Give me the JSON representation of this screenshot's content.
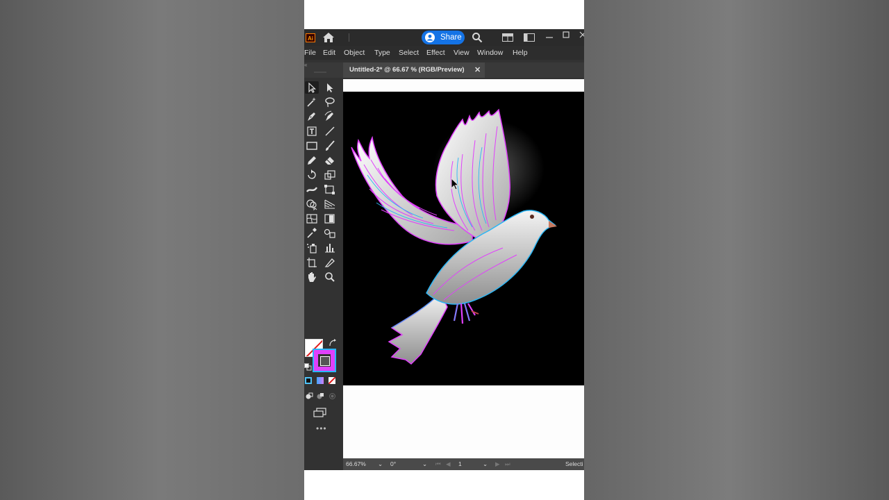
{
  "app": {
    "logo_text": "Ai",
    "share_label": "Share"
  },
  "menu": [
    "File",
    "Edit",
    "Object",
    "Type",
    "Select",
    "Effect",
    "View",
    "Window",
    "Help"
  ],
  "document_tab": {
    "title": "Untitled-2* @ 66.67 % (RGB/Preview)",
    "close_glyph": "✕"
  },
  "status_bar": {
    "zoom": "66.67%",
    "rotation": "0°",
    "artboard": "1",
    "info": "Selecti"
  },
  "toolbar": {
    "more_glyph": "•••"
  },
  "colors": {
    "share_blue": "#1473e6",
    "stroke_magenta": "#e040fb",
    "stroke_cyan": "#29b6f6",
    "artwork_bg": "#000000"
  },
  "icons": [
    "home-icon",
    "user-icon",
    "search-icon",
    "arrange-documents-icon",
    "panel-icon",
    "minimize-icon",
    "maximize-icon",
    "close-icon"
  ]
}
